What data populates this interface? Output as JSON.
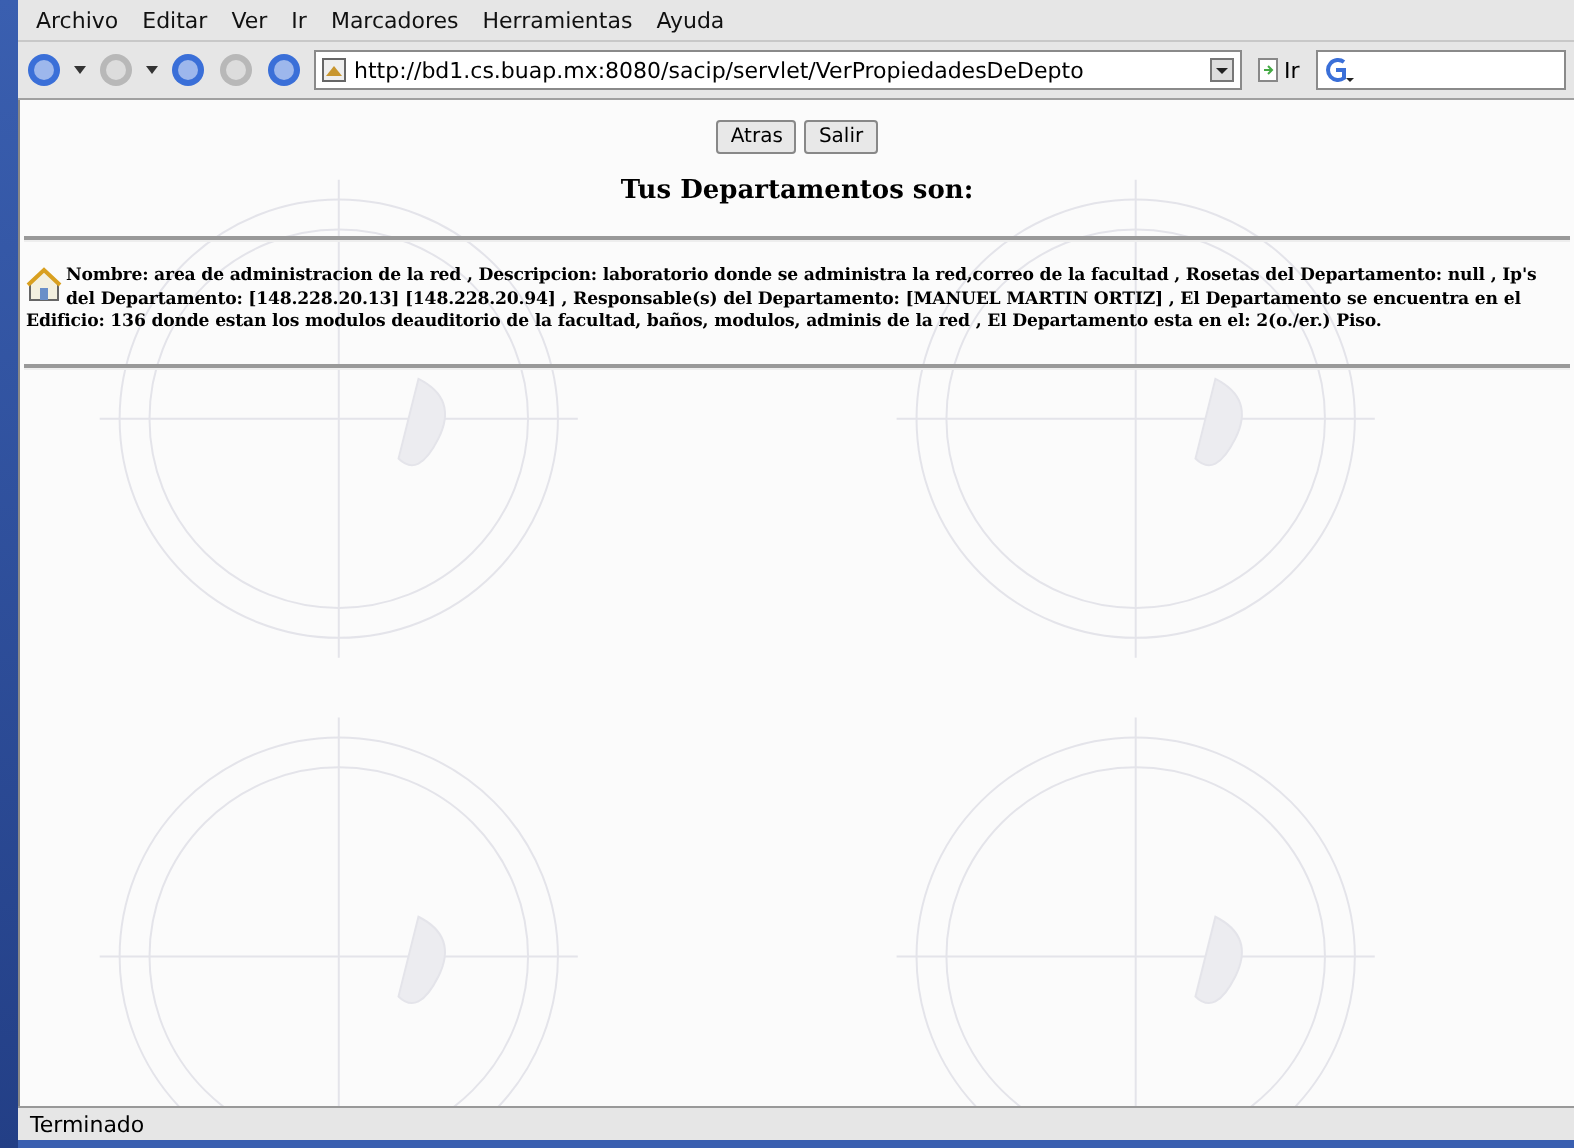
{
  "menu": [
    "Archivo",
    "Editar",
    "Ver",
    "Ir",
    "Marcadores",
    "Herramientas",
    "Ayuda"
  ],
  "toolbar": {
    "url": "http://bd1.cs.buap.mx:8080/sacip/servlet/VerPropiedadesDeDepto",
    "go": "Ir"
  },
  "page": {
    "buttons": [
      "Atras",
      "Salir"
    ],
    "heading": "Tus Departamentos son:",
    "entry": "Nombre: area de administracion de la red , Descripcion: laboratorio donde se administra la red,correo de la facultad , Rosetas del Departamento: null , Ip's del Departamento: [148.228.20.13] [148.228.20.94] , Responsable(s) del Departamento: [MANUEL MARTIN ORTIZ] , El Departamento se encuentra en el Edificio: 136 donde estan los modulos deauditorio de la facultad, baños, modulos, adminis de la red , El Departamento esta en el: 2(o./er.) Piso."
  },
  "status_bar": "Terminado"
}
